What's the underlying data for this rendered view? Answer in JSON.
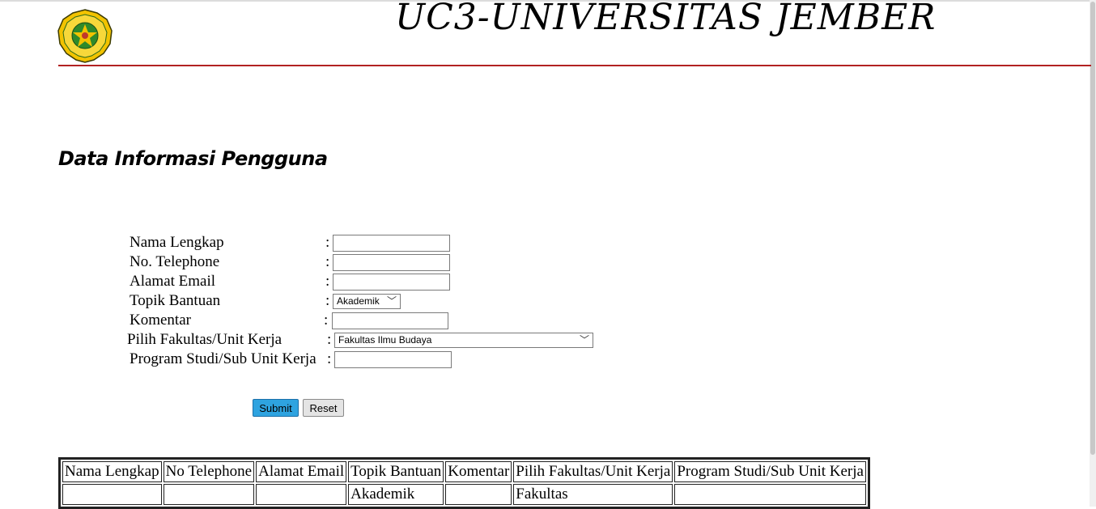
{
  "header": {
    "title": "UC3-UNIVERSITAS JEMBER",
    "logo_icon": "university-seal-icon",
    "rule_color": "#b22222"
  },
  "section": {
    "title": "Data Informasi Pengguna"
  },
  "form": {
    "fields": [
      {
        "label": "Nama Lengkap",
        "colon": ":",
        "value": ""
      },
      {
        "label": "No. Telephone",
        "colon": ":",
        "value": ""
      },
      {
        "label": "Alamat Email",
        "colon": ":",
        "value": ""
      },
      {
        "label": "Topik Bantuan",
        "colon": ":",
        "selected": "Akademik"
      },
      {
        "label": "Komentar",
        "colon": ":",
        "value": ""
      },
      {
        "label": "Pilih Fakultas/Unit Kerja",
        "colon": ":",
        "selected": "Fakultas Ilmu Budaya"
      },
      {
        "label": "Program Studi/Sub Unit Kerja",
        "colon": ":",
        "value": ""
      }
    ],
    "submit_label": "Submit",
    "reset_label": "Reset",
    "submit_color": "#2ea3e0"
  },
  "table": {
    "headers": [
      "Nama Lengkap",
      "No Telephone",
      "Alamat Email",
      "Topik Bantuan",
      "Komentar",
      "Pilih Fakultas/Unit Kerja",
      "Program Studi/Sub Unit Kerja"
    ],
    "rows": [
      [
        "",
        "",
        "",
        "Akademik",
        "",
        "Fakultas",
        ""
      ]
    ]
  }
}
